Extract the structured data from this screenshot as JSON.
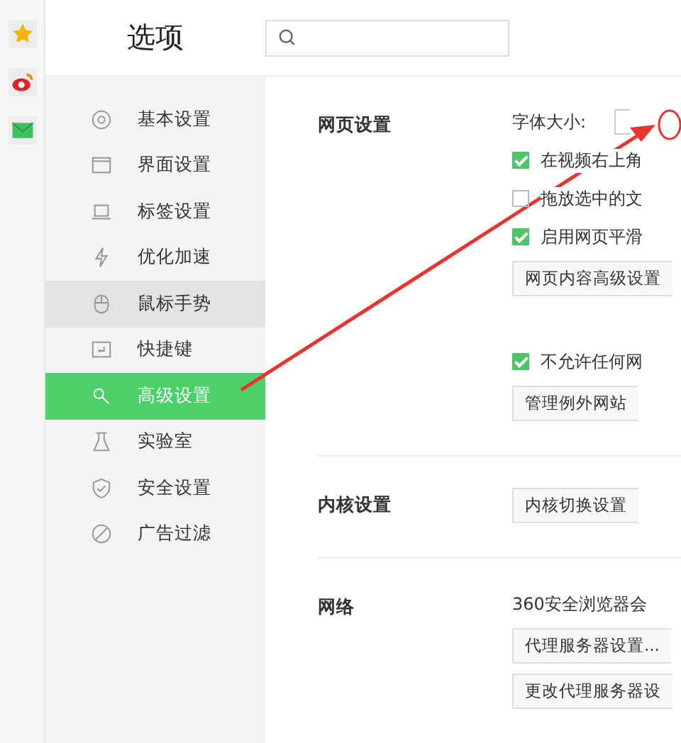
{
  "title": "选项",
  "menu": [
    {
      "label": "基本设置",
      "selected": false,
      "hovered": false
    },
    {
      "label": "界面设置",
      "selected": false,
      "hovered": false
    },
    {
      "label": "标签设置",
      "selected": false,
      "hovered": false
    },
    {
      "label": "优化加速",
      "selected": false,
      "hovered": false
    },
    {
      "label": "鼠标手势",
      "selected": false,
      "hovered": true
    },
    {
      "label": "快捷键",
      "selected": false,
      "hovered": false
    },
    {
      "label": "高级设置",
      "selected": true,
      "hovered": false
    },
    {
      "label": "实验室",
      "selected": false,
      "hovered": false
    },
    {
      "label": "安全设置",
      "selected": false,
      "hovered": false
    },
    {
      "label": "广告过滤",
      "selected": false,
      "hovered": false
    }
  ],
  "sections": [
    {
      "title": "网页设置",
      "items": [
        {
          "kind": "select",
          "label": "字体大小:"
        },
        {
          "kind": "checkbox",
          "label": "在视频右上角",
          "checked": true
        },
        {
          "kind": "checkbox",
          "label": "拖放选中的文",
          "checked": false
        },
        {
          "kind": "checkbox",
          "label": "启用网页平滑",
          "checked": true
        },
        {
          "kind": "button",
          "label": "网页内容高级设置"
        },
        {
          "kind": "spacer"
        },
        {
          "kind": "checkbox",
          "label": "不允许任何网",
          "checked": true
        },
        {
          "kind": "button",
          "label": "管理例外网站"
        }
      ]
    },
    {
      "title": "内核设置",
      "items": [
        {
          "kind": "button",
          "label": "内核切换设置"
        }
      ]
    },
    {
      "title": "网络",
      "items": [
        {
          "kind": "text",
          "label": "360安全浏览器会"
        },
        {
          "kind": "button",
          "label": "代理服务器设置..."
        },
        {
          "kind": "button",
          "label": "更改代理服务器设"
        }
      ]
    }
  ]
}
